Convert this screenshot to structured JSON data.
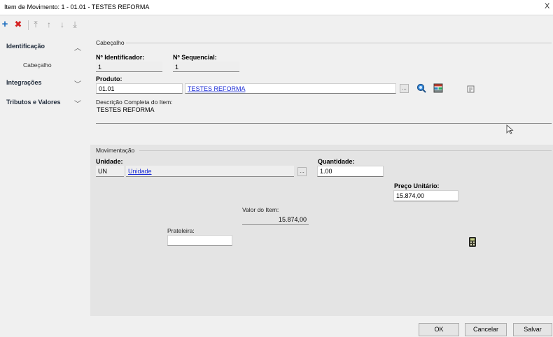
{
  "window": {
    "title": "Item de Movimento: 1 - 01.01 - TESTES REFORMA",
    "close_glyph": "X"
  },
  "toolbar": {
    "add_icon": "+",
    "delete_icon": "✖",
    "first_icon": "⤒",
    "prev_icon": "↑",
    "next_icon": "↓",
    "last_icon": "⤓"
  },
  "sidebar": {
    "items": [
      {
        "label": "Identificação",
        "chevron": "︿",
        "subitems": [
          "Cabeçalho"
        ]
      },
      {
        "label": "Integrações",
        "chevron": "﹀"
      },
      {
        "label": "Tributos e Valores",
        "chevron": "﹀"
      }
    ]
  },
  "cabecalho": {
    "section_title": "Cabeçalho",
    "identificador_label": "Nº Identificador:",
    "identificador_value": "1",
    "sequencial_label": "Nº Sequencial:",
    "sequencial_value": "1",
    "produto_label": "Produto:",
    "produto_code": "01.01",
    "produto_name": "TESTES REFORMA",
    "produto_lookup_btn": "...",
    "descricao_label": "Descrição Completa do Item:",
    "descricao_value": "TESTES REFORMA"
  },
  "movimentacao": {
    "section_title": "Movimentação",
    "unidade_label": "Unidade:",
    "unidade_code": "UN",
    "unidade_name": "Unidade",
    "unidade_lookup_btn": "...",
    "quantidade_label": "Quantidade:",
    "quantidade_value": "1.00",
    "preco_label": "Preço Unitário:",
    "preco_value": "15.874,00",
    "valor_label": "Valor do Item:",
    "valor_value": "15.874,00",
    "prateleira_label": "Prateleira:",
    "prateleira_value": ""
  },
  "footer": {
    "ok_label": "OK",
    "cancel_label": "Cancelar",
    "save_label": "Salvar"
  },
  "colors": {
    "link": "#1a2bd6",
    "add_icon": "#1f6fbf",
    "delete_icon": "#d42020"
  }
}
